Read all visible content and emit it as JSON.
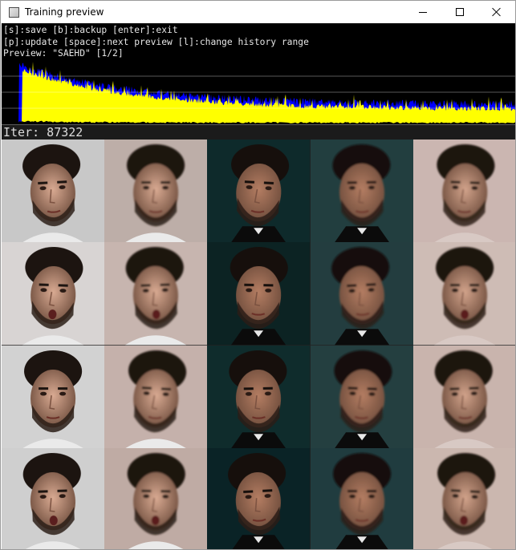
{
  "window": {
    "title": "Training preview",
    "icon": "app-window-icon",
    "controls": [
      "minimize-icon",
      "maximize-icon",
      "close-icon"
    ]
  },
  "console": {
    "lines": [
      "[s]:save [b]:backup [enter]:exit",
      "[p]:update [space]:next preview [l]:change history range",
      "Preview: \"SAEHD\" [1/2]"
    ]
  },
  "graph": {
    "background": "#000000",
    "colors": {
      "src_loss": "#ffff00",
      "dst_loss": "#0000ff",
      "gridline": "#ffffff"
    }
  },
  "status": {
    "iter_label": "Iter: 87322"
  },
  "preview": {
    "columns": 5,
    "rows": [
      [
        {
          "subject": "bearded-man-source",
          "variant": "original",
          "bg": "#c8c8c8"
        },
        {
          "subject": "bearded-man-source",
          "variant": "reconstruction",
          "bg": "#b9a9a3"
        },
        {
          "subject": "actor-destination",
          "variant": "original",
          "bg": "#0e2a2b"
        },
        {
          "subject": "actor-destination",
          "variant": "reconstruction",
          "bg": "#153234"
        },
        {
          "subject": "swap-result",
          "variant": "swapped",
          "bg": "#c8b2ad"
        }
      ],
      [
        {
          "subject": "bearded-man-source",
          "variant": "original",
          "bg": "#d8d4d3"
        },
        {
          "subject": "bearded-man-source",
          "variant": "reconstruction",
          "bg": "#c4b1aa"
        },
        {
          "subject": "actor-destination",
          "variant": "original",
          "bg": "#0c2323"
        },
        {
          "subject": "actor-destination",
          "variant": "reconstruction",
          "bg": "#163133"
        },
        {
          "subject": "swap-result",
          "variant": "swapped",
          "bg": "#cbb8b1"
        }
      ],
      [
        {
          "subject": "bearded-man-source",
          "variant": "original",
          "bg": "#d2d2d2"
        },
        {
          "subject": "bearded-man-source",
          "variant": "reconstruction",
          "bg": "#c2ada6"
        },
        {
          "subject": "actor-destination",
          "variant": "original",
          "bg": "#0f2c2c"
        },
        {
          "subject": "actor-destination",
          "variant": "reconstruction",
          "bg": "#173435"
        },
        {
          "subject": "swap-result",
          "variant": "swapped",
          "bg": "#c6b0a8"
        }
      ],
      [
        {
          "subject": "bearded-man-source",
          "variant": "original",
          "bg": "#cfcfcf"
        },
        {
          "subject": "bearded-man-source",
          "variant": "reconstruction",
          "bg": "#bba69f"
        },
        {
          "subject": "actor-destination",
          "variant": "original",
          "bg": "#0a2326"
        },
        {
          "subject": "actor-destination",
          "variant": "reconstruction",
          "bg": "#133034"
        },
        {
          "subject": "swap-result",
          "variant": "swapped",
          "bg": "#c8b3ab"
        }
      ]
    ]
  }
}
